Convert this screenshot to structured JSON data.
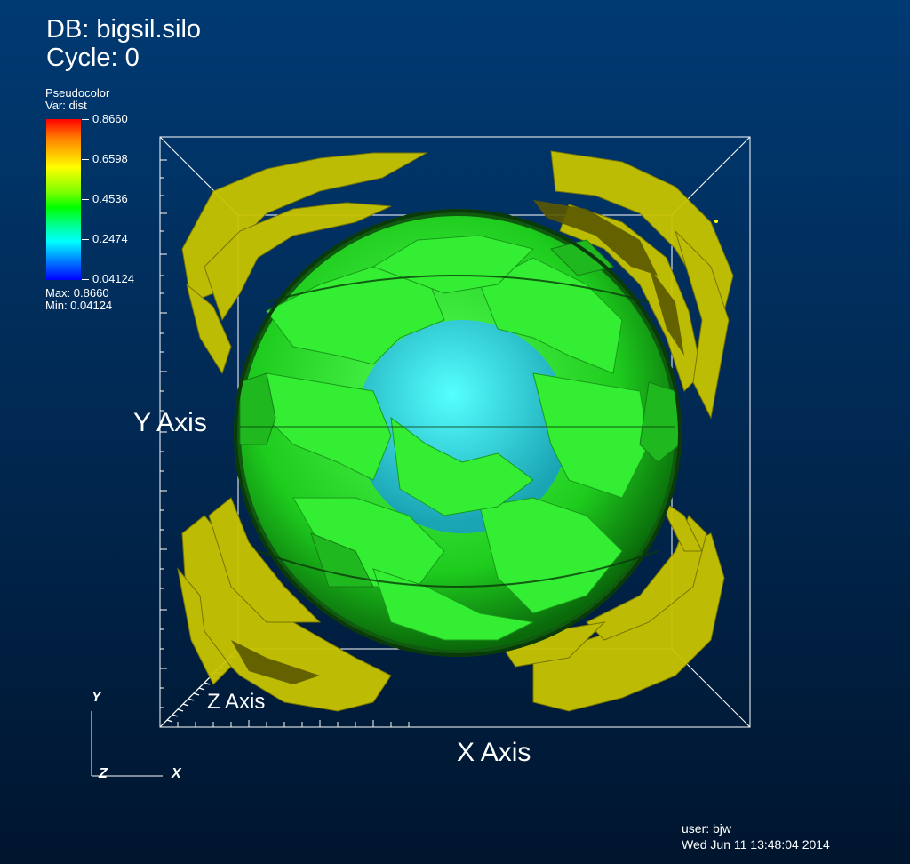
{
  "annotations": {
    "database": "DB: bigsil.silo",
    "cycle": "Cycle: 0",
    "user": "user: bjw",
    "timestamp": "Wed Jun 11 13:48:04 2014"
  },
  "legend": {
    "plot_type": "Pseudocolor",
    "variable": "Var: dist",
    "ticks": [
      "0.8660",
      "0.6598",
      "0.4536",
      "0.2474",
      "0.04124"
    ],
    "max_label": "Max:  0.8660",
    "min_label": "Min:  0.04124",
    "max_value": 0.866,
    "min_value": 0.04124,
    "colormap": [
      "#ff0000",
      "#ff8000",
      "#ffff00",
      "#00ff00",
      "#00ffff",
      "#0080ff",
      "#0000ff"
    ]
  },
  "axes": {
    "x_title": "X Axis",
    "y_title": "Y Axis",
    "z_title": "Z Axis"
  },
  "triad": {
    "x": "X",
    "y": "Y",
    "z": "Z"
  },
  "colors": {
    "background_top": "#003a73",
    "background_bottom": "#00152e",
    "isosurface_outer": "#c8c800",
    "isosurface_middle": "#22dd22",
    "isosurface_inner": "#33e6e6"
  }
}
